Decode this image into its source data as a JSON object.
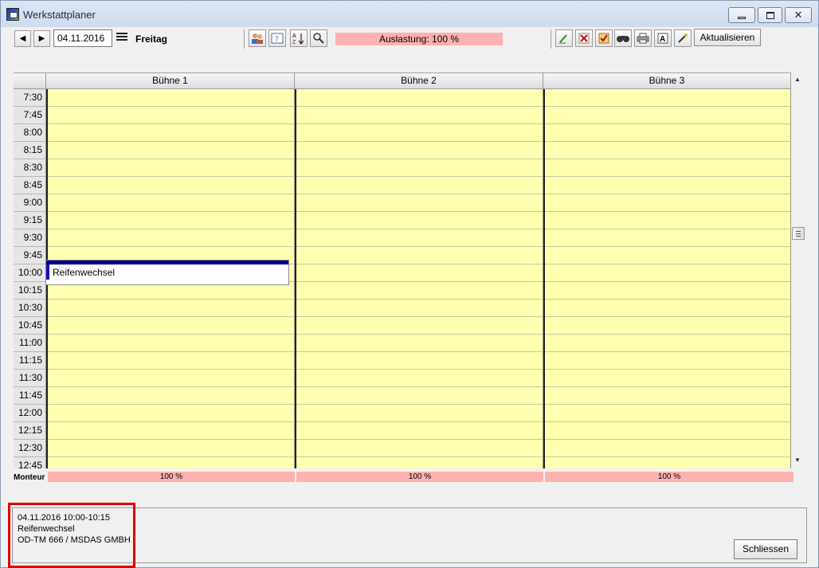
{
  "window": {
    "title": "Werkstattplaner"
  },
  "toolbar": {
    "date": "04.11.2016",
    "day": "Freitag",
    "load_label": "Auslastung: 100 %",
    "refresh_label": "Aktualisieren"
  },
  "grid": {
    "stages": [
      "Bühne 1",
      "Bühne 2",
      "Bühne 3"
    ],
    "times": [
      "7:30",
      "7:45",
      "8:00",
      "8:15",
      "8:30",
      "8:45",
      "9:00",
      "9:15",
      "9:30",
      "9:45",
      "10:00",
      "10:15",
      "10:30",
      "10:45",
      "11:00",
      "11:15",
      "11:30",
      "11:45",
      "12:00",
      "12:15",
      "12:30",
      "12:45"
    ],
    "appointment": {
      "label": "Reifenwechsel",
      "stage": "Bühne 1",
      "start": "10:00"
    }
  },
  "monteur": {
    "label": "Monteur",
    "values": [
      "100 %",
      "100 %",
      "100 %"
    ]
  },
  "detail": {
    "line1": "04.11.2016 10:00-10:15",
    "line2": "Reifenwechsel",
    "line3": "OD-TM 666 / MSDAS GMBH"
  },
  "buttons": {
    "close_label": "Schliessen"
  },
  "colors": {
    "slot": "#ffffb0",
    "load": "#ffb0b0",
    "appointment_bar": "#000080",
    "highlight": "#e00000"
  }
}
